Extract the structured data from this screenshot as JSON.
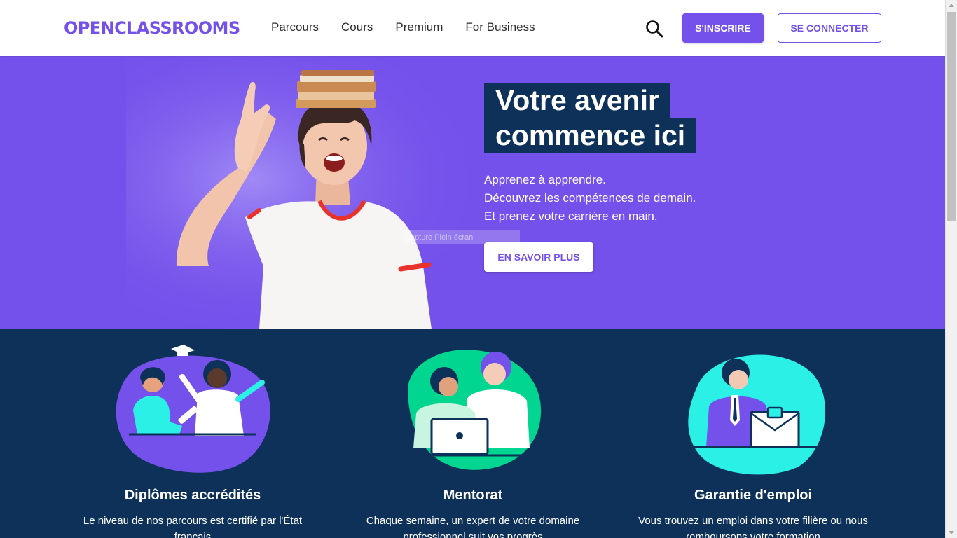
{
  "header": {
    "logo": "OPENCLASSROOMS",
    "nav": [
      "Parcours",
      "Cours",
      "Premium",
      "For Business"
    ],
    "search_icon": "search-icon",
    "signup_label": "S'INSCRIRE",
    "login_label": "SE CONNECTER"
  },
  "hero": {
    "headline_line1": "Votre avenir",
    "headline_line2": "commence ici",
    "tagline_line1": "Apprenez à apprendre.",
    "tagline_line2": "Découvrez les compétences de demain.",
    "tagline_line3": "Et prenez votre carrière en main.",
    "cta_label": "EN SAVOIR PLUS",
    "overlay_text": "Capture Plein écran",
    "image": "student-with-books-photo"
  },
  "features": [
    {
      "icon": "graduates-illustration",
      "title": "Diplômes accrédités",
      "description": "Le niveau de nos parcours est certifié par l'État français"
    },
    {
      "icon": "mentoring-illustration",
      "title": "Mentorat",
      "description": "Chaque semaine, un expert de votre domaine professionnel suit vos progrès"
    },
    {
      "icon": "job-guarantee-illustration",
      "title": "Garantie d'emploi",
      "description": "Vous trouvez un emploi dans votre filière ou nous remboursons votre formation"
    }
  ],
  "colors": {
    "brand_purple": "#7451eb",
    "navy": "#0d3158",
    "teal": "#2af0e6",
    "mint": "#00d68f"
  }
}
